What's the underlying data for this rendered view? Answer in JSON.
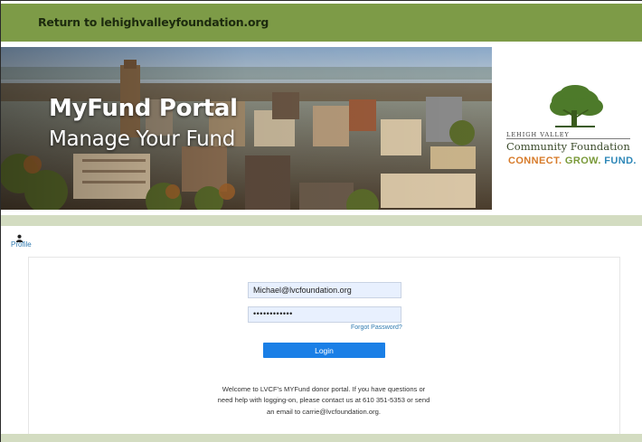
{
  "topbar": {
    "return_link": "Return to lehighvalleyfoundation.org"
  },
  "banner": {
    "title": "MyFund Portal",
    "subtitle": "Manage Your Fund"
  },
  "logo": {
    "kicker": "LEHIGH VALLEY",
    "name": "Community Foundation",
    "tagline": {
      "connect": "CONNECT.",
      "grow": "GROW.",
      "fund": "FUND."
    }
  },
  "profile": {
    "label": "Profile"
  },
  "login": {
    "email_value": "Michael@lvcfoundation.org",
    "password_value": "••••••••••••",
    "forgot_label": "Forgot Password?",
    "button_label": "Login"
  },
  "welcome": {
    "text": "Welcome to LVCF's MYFund donor portal. If you have questions or need help with logging-on, please contact us at 610 351-5353 or send an email to carrie@lvcfoundation.org."
  },
  "colors": {
    "topbar": "#7d9b47",
    "band": "#d3dcc1",
    "login_button": "#1a7fe6",
    "link": "#2f7ab0",
    "field_bg": "#e8f0fe"
  }
}
